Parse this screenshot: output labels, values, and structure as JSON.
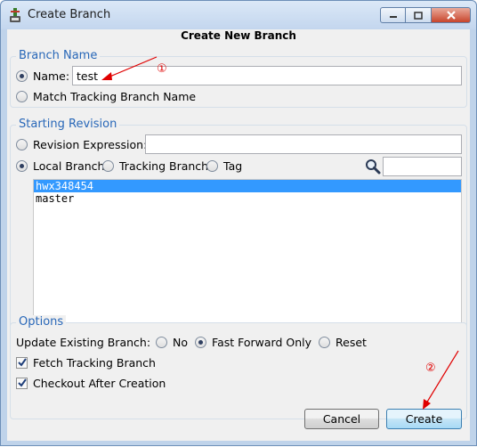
{
  "window": {
    "title": "Create Branch"
  },
  "dialog": {
    "heading": "Create New Branch"
  },
  "branch_name": {
    "legend": "Branch Name",
    "name_label": "Name:",
    "name_value": "test",
    "match_label": "Match Tracking Branch Name"
  },
  "starting_revision": {
    "legend": "Starting Revision",
    "revision_label": "Revision Expression:",
    "revision_value": "",
    "local_label": "Local Branch",
    "tracking_label": "Tracking Branch",
    "tag_label": "Tag",
    "filter_value": "",
    "branches": [
      "hwx348454",
      "master"
    ],
    "selected_branch": "hwx348454"
  },
  "options": {
    "legend": "Options",
    "update_label": "Update Existing Branch:",
    "no_label": "No",
    "ff_label": "Fast Forward Only",
    "reset_label": "Reset",
    "fetch_label": "Fetch Tracking Branch",
    "checkout_label": "Checkout After Creation"
  },
  "buttons": {
    "cancel": "Cancel",
    "create": "Create"
  },
  "annotations": {
    "one": "①",
    "two": "②"
  },
  "colors": {
    "accent": "#2867b8",
    "selection": "#3399ff",
    "annotation": "#e00000"
  },
  "icons": {
    "app": "git-app-icon",
    "filter": "search-icon"
  }
}
